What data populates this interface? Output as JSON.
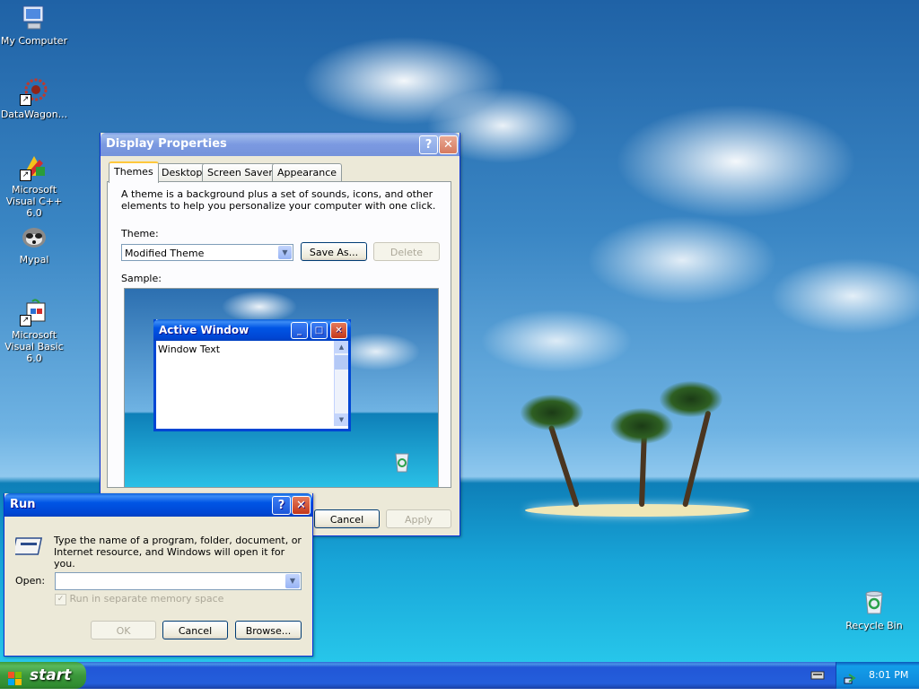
{
  "desktop": {
    "icons": [
      {
        "label": "My Computer",
        "icon": "my-computer-icon"
      },
      {
        "label": "DataWagon...",
        "icon": "datawagon-icon"
      },
      {
        "label": "Microsoft Visual C++ 6.0",
        "icon": "visual-cpp-icon"
      },
      {
        "label": "Mypal",
        "icon": "mypal-icon"
      },
      {
        "label": "Microsoft Visual Basic 6.0",
        "icon": "visual-basic-icon"
      },
      {
        "label": "Recycle Bin",
        "icon": "recycle-bin-icon"
      }
    ]
  },
  "display_properties": {
    "title": "Display Properties",
    "help_glyph": "?",
    "close_glyph": "✕",
    "tabs": [
      "Themes",
      "Desktop",
      "Screen Saver",
      "Appearance"
    ],
    "active_tab": "Themes",
    "description": "A theme is a background plus a set of sounds, icons, and other elements to help you personalize your computer with one click.",
    "theme_label": "Theme:",
    "theme_value": "Modified Theme",
    "save_as_label": "Save As...",
    "delete_label": "Delete",
    "sample_label": "Sample:",
    "sample_window_title": "Active Window",
    "sample_window_text": "Window Text",
    "cancel_label": "Cancel",
    "apply_label": "Apply"
  },
  "run_dialog": {
    "title": "Run",
    "help_glyph": "?",
    "close_glyph": "✕",
    "description": "Type the name of a program, folder, document, or Internet resource, and Windows will open it for you.",
    "open_label": "Open:",
    "open_value": "",
    "checkbox_label": "Run in separate memory space",
    "checkbox_checked": true,
    "ok_label": "OK",
    "cancel_label": "Cancel",
    "browse_label": "Browse..."
  },
  "taskbar": {
    "start_label": "start",
    "clock": "8:01 PM"
  },
  "colors": {
    "xp_blue": "#0055e5",
    "start_green": "#3c983c",
    "dialog_face": "#ece9d8"
  }
}
